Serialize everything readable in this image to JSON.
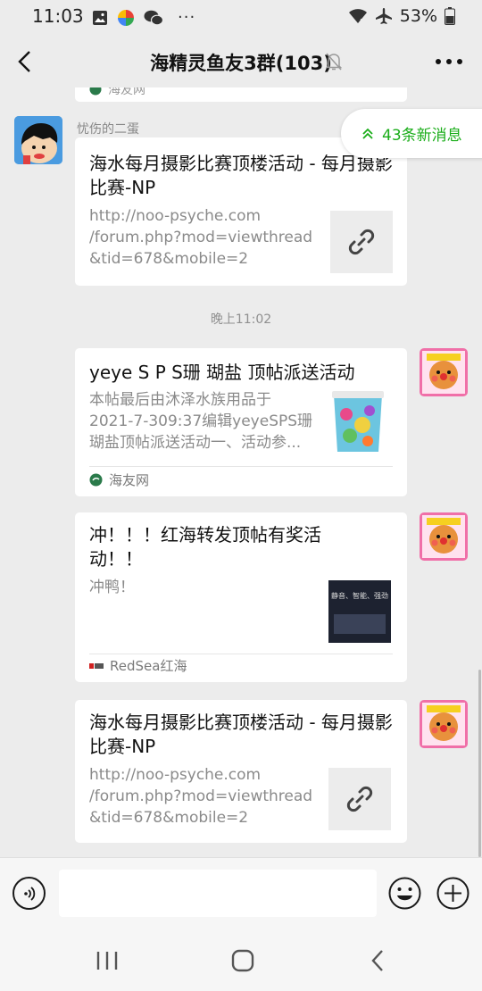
{
  "status": {
    "time": "11:03",
    "battery": "53%",
    "more": "···"
  },
  "header": {
    "title": "海精灵鱼友3群(103)"
  },
  "new_messages": {
    "label": "43条新消息"
  },
  "messages": [
    {
      "type": "partial_source",
      "source": "海友网"
    },
    {
      "type": "link",
      "sender": "忧伤的二蛋",
      "title": "海水每月摄影比赛顶楼活动 - 每月摄影比赛-NP",
      "url_lines": [
        "http://noo-psyche.com",
        "/forum.php?mod=viewthread",
        "&tid=678&mobile=2"
      ]
    },
    {
      "type": "time",
      "text": "晚上11:02"
    },
    {
      "type": "article",
      "title": "yeye S P S珊 瑚盐 顶帖派送活动",
      "desc_lines": [
        "本帖最后由沐泽水族用品于",
        "2021-7-309:37编辑yeyeSPS珊",
        "瑚盐顶帖派送活动一、活动参..."
      ],
      "source": "海友网"
    },
    {
      "type": "article",
      "title_lines": [
        "冲！！！红海转发顶帖有奖活",
        "动！！"
      ],
      "desc": "冲鸭！",
      "thumb_text": "静音、智能、强劲",
      "source": "RedSea红海"
    },
    {
      "type": "link",
      "title": "海水每月摄影比赛顶楼活动 - 每月摄影比赛-NP",
      "url_lines": [
        "http://noo-psyche.com",
        "/forum.php?mod=viewthread",
        "&tid=678&mobile=2"
      ]
    }
  ],
  "colors": {
    "background": "#ececec",
    "accent_green": "#1aad19",
    "card": "#ffffff"
  },
  "icons": {
    "back": "chevron-left-icon",
    "mute": "bell-off-icon",
    "more": "more-dots-icon",
    "link": "link-icon",
    "voice": "voice-icon",
    "emoji": "emoji-icon",
    "plus": "plus-circle-icon"
  }
}
